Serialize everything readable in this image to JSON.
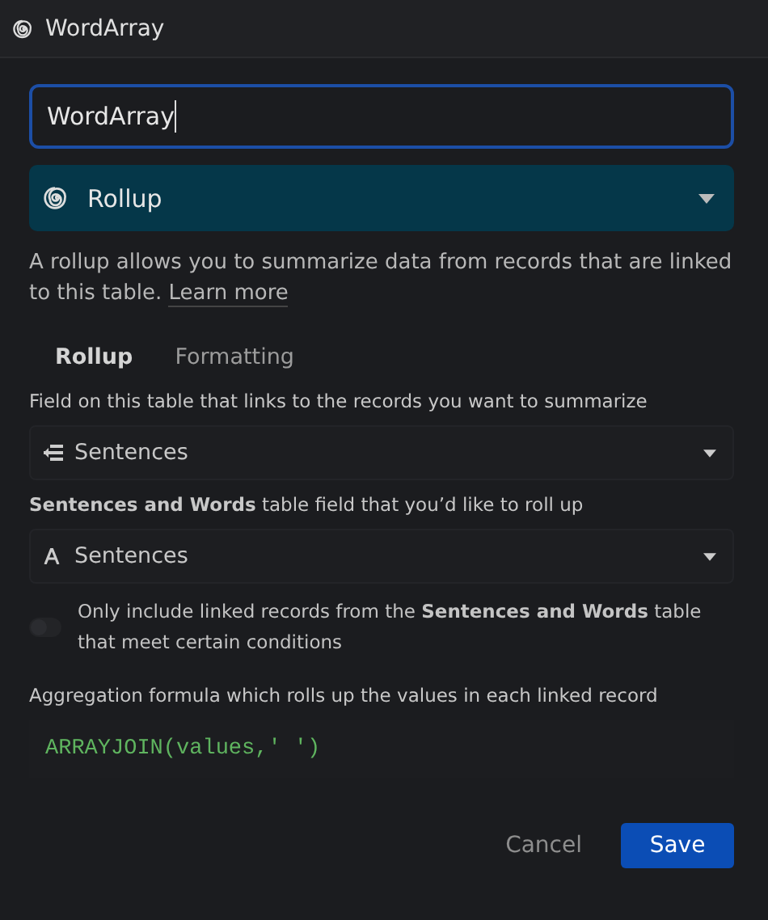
{
  "window": {
    "title": "WordArray"
  },
  "name_field": {
    "value": "WordArray"
  },
  "type_select": {
    "value": "Rollup"
  },
  "description": {
    "text": "A rollup allows you to summarize data from records that are linked to this table.",
    "link": "Learn more"
  },
  "tabs": [
    {
      "label": "Rollup",
      "selected": true
    },
    {
      "label": "Formatting",
      "selected": false
    }
  ],
  "fields": [
    {
      "label": "Field on this table that links to the records you want to summarize",
      "value": "Sentences",
      "kind": "link"
    },
    {
      "label": "**Sentences and Words** table field that you’d like to roll up",
      "value": "Sentences",
      "kind": "text"
    }
  ],
  "filter_toggle": {
    "on": false,
    "label": "Only include linked records from the **Sentences and Words** table that meet certain conditions"
  },
  "formula": {
    "label": "Aggregation formula which rolls up the values in each linked record",
    "value": "ARRAYJOIN(values,' ')"
  },
  "buttons": {
    "cancel": "Cancel",
    "save": "Save"
  }
}
